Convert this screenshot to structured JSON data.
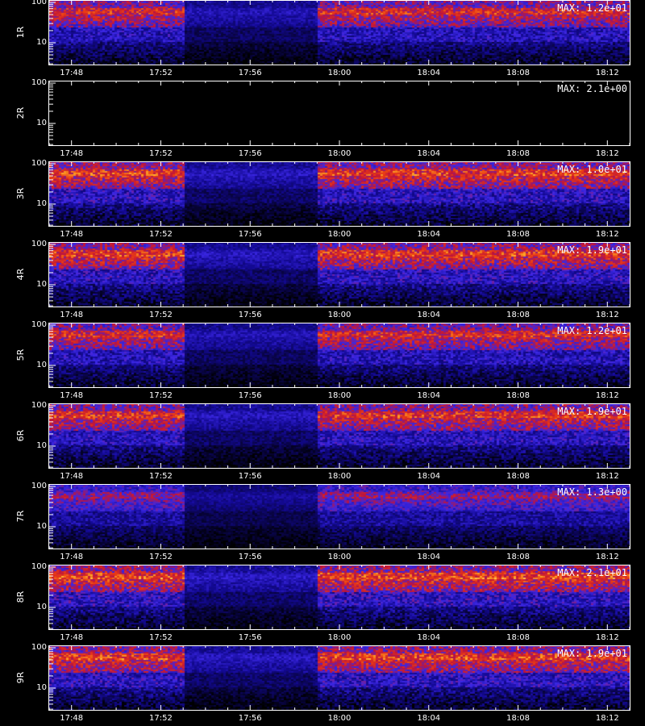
{
  "chart_data": [
    {
      "type": "heatmap",
      "panel_label": "1R",
      "max_label": "MAX: 1.2e+01",
      "y_scale": "log",
      "y_ticks": [
        "100",
        "10"
      ],
      "x_ticks": [
        "17:48",
        "17:52",
        "17:56",
        "18:00",
        "18:04",
        "18:08",
        "18:12"
      ],
      "x_range": [
        "17:47",
        "18:13"
      ],
      "low_activity_interval": [
        "17:53",
        "17:59"
      ],
      "intensity": 0.85
    },
    {
      "type": "heatmap",
      "panel_label": "2R",
      "max_label": "MAX: 2.1e+00",
      "y_scale": "log",
      "y_ticks": [
        "100",
        "10"
      ],
      "x_ticks": [
        "17:48",
        "17:52",
        "17:56",
        "18:00",
        "18:04",
        "18:08",
        "18:12"
      ],
      "x_range": [
        "17:47",
        "18:13"
      ],
      "low_activity_interval": [],
      "intensity": 0.0
    },
    {
      "type": "heatmap",
      "panel_label": "3R",
      "max_label": "MAX: 1.0e+01",
      "y_scale": "log",
      "y_ticks": [
        "100",
        "10"
      ],
      "x_ticks": [
        "17:48",
        "17:52",
        "17:56",
        "18:00",
        "18:04",
        "18:08",
        "18:12"
      ],
      "x_range": [
        "17:47",
        "18:13"
      ],
      "low_activity_interval": [
        "17:53",
        "17:59"
      ],
      "intensity": 0.9
    },
    {
      "type": "heatmap",
      "panel_label": "4R",
      "max_label": "MAX: 1.9e+01",
      "y_scale": "log",
      "y_ticks": [
        "100",
        "10"
      ],
      "x_ticks": [
        "17:48",
        "17:52",
        "17:56",
        "18:00",
        "18:04",
        "18:08",
        "18:12"
      ],
      "x_range": [
        "17:47",
        "18:13"
      ],
      "low_activity_interval": [
        "17:53",
        "17:59"
      ],
      "intensity": 0.9
    },
    {
      "type": "heatmap",
      "panel_label": "5R",
      "max_label": "MAX: 1.2e+01",
      "y_scale": "log",
      "y_ticks": [
        "100",
        "10"
      ],
      "x_ticks": [
        "17:48",
        "17:52",
        "17:56",
        "18:00",
        "18:04",
        "18:08",
        "18:12"
      ],
      "x_range": [
        "17:47",
        "18:13"
      ],
      "low_activity_interval": [
        "17:53",
        "17:59"
      ],
      "intensity": 0.85
    },
    {
      "type": "heatmap",
      "panel_label": "6R",
      "max_label": "MAX: 1.9e+01",
      "y_scale": "log",
      "y_ticks": [
        "100",
        "10"
      ],
      "x_ticks": [
        "17:48",
        "17:52",
        "17:56",
        "18:00",
        "18:04",
        "18:08",
        "18:12"
      ],
      "x_range": [
        "17:47",
        "18:13"
      ],
      "low_activity_interval": [
        "17:53",
        "17:59"
      ],
      "intensity": 0.88
    },
    {
      "type": "heatmap",
      "panel_label": "7R",
      "max_label": "MAX: 1.3e+00",
      "y_scale": "log",
      "y_ticks": [
        "100",
        "10"
      ],
      "x_ticks": [
        "17:48",
        "17:52",
        "17:56",
        "18:00",
        "18:04",
        "18:08",
        "18:12"
      ],
      "x_range": [
        "17:47",
        "18:13"
      ],
      "low_activity_interval": [
        "17:53",
        "17:59"
      ],
      "intensity": 0.7
    },
    {
      "type": "heatmap",
      "panel_label": "8R",
      "max_label": "MAX: 2.1e+01",
      "y_scale": "log",
      "y_ticks": [
        "100",
        "10"
      ],
      "x_ticks": [
        "17:48",
        "17:52",
        "17:56",
        "18:00",
        "18:04",
        "18:08",
        "18:12"
      ],
      "x_range": [
        "17:47",
        "18:13"
      ],
      "low_activity_interval": [
        "17:53",
        "17:59"
      ],
      "intensity": 0.92
    },
    {
      "type": "heatmap",
      "panel_label": "9R",
      "max_label": "MAX: 1.9e+01",
      "y_scale": "log",
      "y_ticks": [
        "100",
        "10"
      ],
      "x_ticks": [
        "17:48",
        "17:52",
        "17:56",
        "18:00",
        "18:04",
        "18:08",
        "18:12"
      ],
      "x_range": [
        "17:47",
        "18:13"
      ],
      "low_activity_interval": [
        "17:53",
        "17:59"
      ],
      "intensity": 0.9
    }
  ],
  "colors": {
    "background": "#000000",
    "axes": "#ffffff",
    "low": "#1010a0",
    "mid": "#d02020",
    "high": "#ffe060"
  }
}
